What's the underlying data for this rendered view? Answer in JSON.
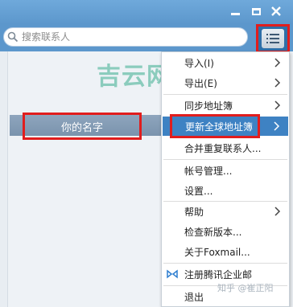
{
  "search": {
    "placeholder": "搜索联系人"
  },
  "watermark": {
    "text": "吉云网"
  },
  "contact": {
    "name": "你的名字"
  },
  "menu": {
    "items": [
      {
        "label": "导入(I)",
        "submenu": true
      },
      {
        "label": "导出(E)",
        "submenu": true
      },
      {
        "label": "同步地址簿",
        "submenu": true
      },
      {
        "label": "更新全球地址簿",
        "submenu": true,
        "highlighted": true
      },
      {
        "label": "合并重复联系人...",
        "submenu": false
      },
      {
        "label": "帐号管理...",
        "submenu": false
      },
      {
        "label": "设置...",
        "submenu": false
      },
      {
        "label": "帮助",
        "submenu": true
      },
      {
        "label": "检查新版本...",
        "submenu": false
      },
      {
        "label": "关于Foxmail...",
        "submenu": false
      },
      {
        "label": "注册腾讯企业邮",
        "submenu": false,
        "icon": "tencent-exmail-icon"
      },
      {
        "label": "退出",
        "submenu": false
      }
    ]
  },
  "credit": {
    "text": "知乎 @崔正阳"
  },
  "colors": {
    "titlebar": "#5c97cc",
    "highlight": "#3e82c3",
    "annotation_red": "#e11d1d",
    "watermark": "#3cae8f"
  }
}
